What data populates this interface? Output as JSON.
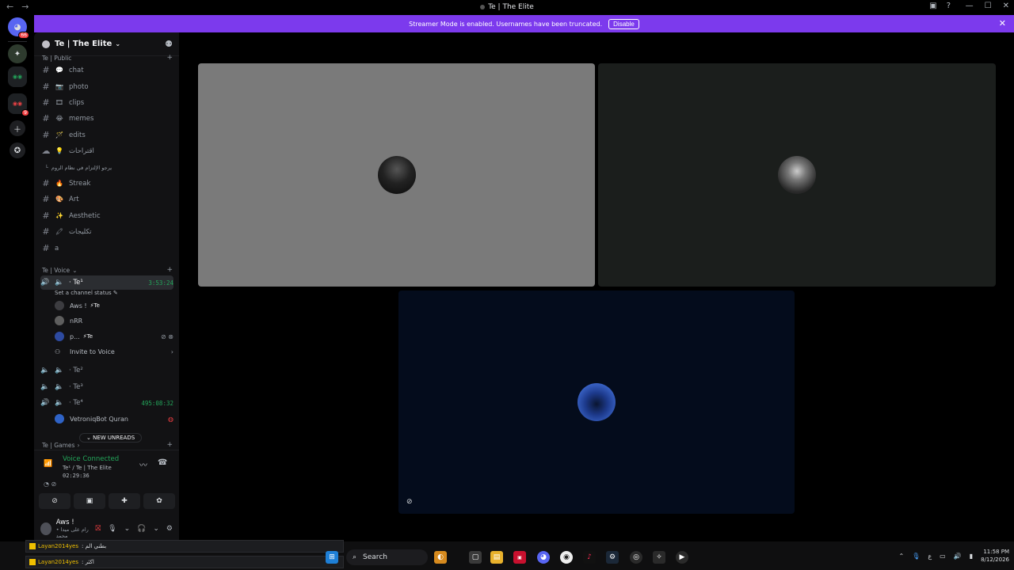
{
  "window": {
    "title": "Te | The Elite"
  },
  "rail": {
    "home_badge": "66",
    "server_badge": "9"
  },
  "banner": {
    "message": "Streamer Mode is enabled. Usernames have been truncated.",
    "disable_label": "Disable"
  },
  "guild": {
    "name": "Te | The Elite"
  },
  "categories": {
    "public": "Te | Public",
    "voice": "Te | Voice",
    "games": "Te | Games"
  },
  "text_channels": [
    {
      "emoji": "💬",
      "name": "chat"
    },
    {
      "emoji": "📷",
      "name": "photo"
    },
    {
      "emoji": "🎞",
      "name": "clips"
    },
    {
      "emoji": "😂",
      "name": "memes"
    },
    {
      "emoji": "🪄",
      "name": "edits"
    },
    {
      "emoji": "💡",
      "name": "اقتراحات"
    },
    {
      "emoji": "",
      "name": "يرجو الإلتزام في نظام الروم"
    },
    {
      "emoji": "🔥",
      "name": "Streak"
    },
    {
      "emoji": "🎨",
      "name": "Art"
    },
    {
      "emoji": "✨",
      "name": "Aesthetic"
    },
    {
      "emoji": "🖍",
      "name": "تكليجات"
    },
    {
      "emoji": "",
      "name": "a"
    }
  ],
  "voice_channels": [
    {
      "name": "· Te¹",
      "time": "3:53:24"
    },
    {
      "name": "· Te²",
      "time": ""
    },
    {
      "name": "· Te³",
      "time": ""
    },
    {
      "name": "· Te⁴",
      "time": "495:08:32"
    }
  ],
  "channel_status": "Set a channel status ✎",
  "voice_members": [
    {
      "name": "Aws !",
      "tag": "⚡Te"
    },
    {
      "name": "nRR",
      "tag": ""
    },
    {
      "name": "p...",
      "tag": "⚡Te"
    }
  ],
  "invite_label": "Invite to Voice",
  "bot_member": "VetroniqBot Quran",
  "new_unreads": "NEW UNREADS",
  "voice_panel": {
    "status": "Voice Connected",
    "channel": "Te¹ / Te | The Elite",
    "elapsed": "02:29:36"
  },
  "user": {
    "name": "Aws !",
    "status": "• رام على ميدا محمد"
  },
  "notifications": [
    {
      "user": "Layan2014yes",
      "msg": ": بطني الم"
    },
    {
      "user": "Layan2014yes",
      "msg": ": اكثر"
    }
  ],
  "taskbar": {
    "search_label": "Search",
    "time": "11:58 PM",
    "date": "8/12/2026",
    "lang": "ع"
  },
  "tiles": {
    "tile1_bg": "#7a7a7a",
    "tile2_bg": "#1b1e1c",
    "tile3_bg": "#040c1c"
  }
}
